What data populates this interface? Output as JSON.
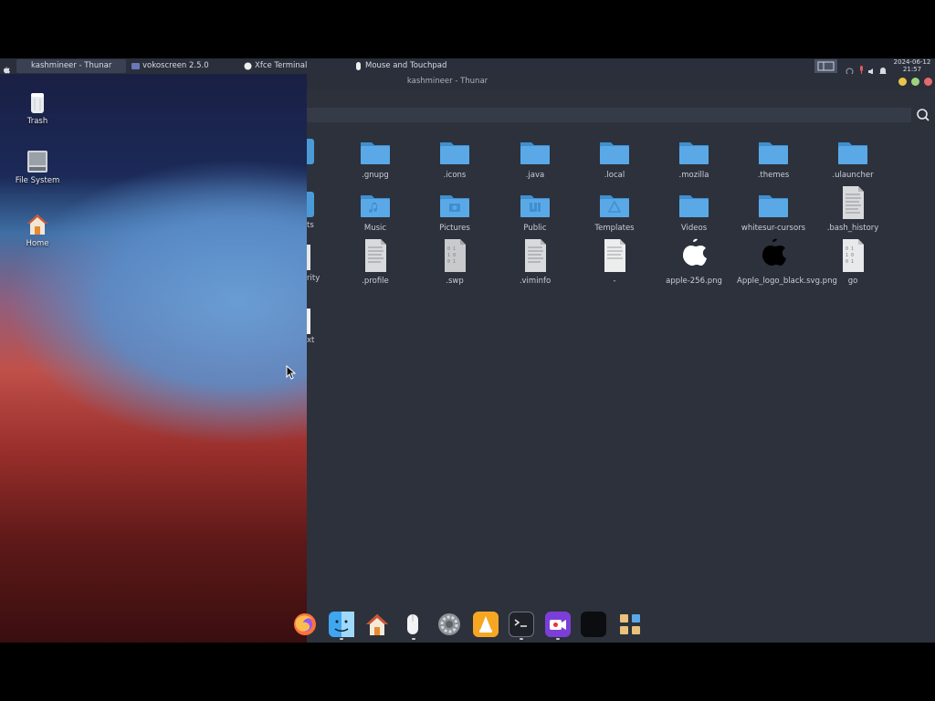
{
  "taskbar": {
    "tasks": [
      {
        "label": "kashmineer - Thunar",
        "active": true
      },
      {
        "label": "vokoscreen 2.5.0",
        "active": false
      },
      {
        "label": "Xfce Terminal",
        "active": false
      },
      {
        "label": "Mouse and Touchpad",
        "active": false
      }
    ],
    "clock": {
      "date": "2024-06-12",
      "time": "21:57"
    }
  },
  "desktop": {
    "icons": [
      {
        "label": "Trash",
        "icon": "trash-icon"
      },
      {
        "label": "File System",
        "icon": "drive-icon"
      },
      {
        "label": "Home",
        "icon": "home-icon"
      }
    ]
  },
  "window": {
    "title": "kashmineer - Thunar",
    "controls": {
      "minimize_color": "#e8c44e",
      "maximize_color": "#9fd27b",
      "close_color": "#e36b6b"
    }
  },
  "files": {
    "row1": [
      ".gnupg",
      ".icons",
      ".java",
      ".local",
      ".mozilla",
      ".themes",
      ".ulauncher"
    ],
    "row2": [
      "Music",
      "Pictures",
      "Public",
      "Templates",
      "Videos",
      "whitesur-cursors",
      ".bash_history"
    ],
    "row3": [
      ".profile",
      ".swp",
      ".viminfo",
      "-",
      "apple-256.png",
      "Apple_logo_black.svg.png",
      "go"
    ],
    "partial": [
      "ts",
      "rity",
      "xt"
    ]
  },
  "colors": {
    "folder": "#5aa9e6",
    "folder_dark": "#3f8fd0",
    "bg": "#2c313c"
  }
}
